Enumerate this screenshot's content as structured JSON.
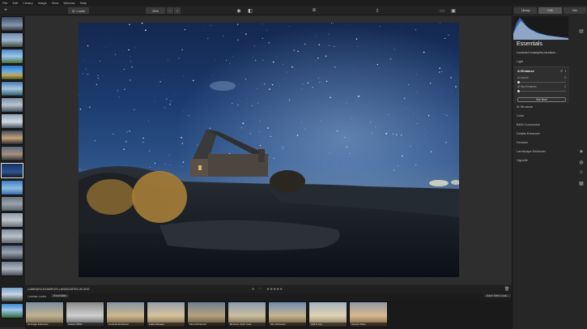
{
  "menu": [
    "File",
    "Edit",
    "Library",
    "Image",
    "View",
    "Window",
    "Help"
  ],
  "toolbar": {
    "looks_label": "Looks",
    "zoom_label": "39%",
    "zoom_minus": "−",
    "zoom_plus": "+"
  },
  "right_tabs": [
    "Library",
    "Edit",
    "Info"
  ],
  "panel": {
    "title": "Essentials",
    "preset": "Luminar4 examples-landsca…",
    "sections_top": "Light",
    "ai_enhance": {
      "title": "AI Enhance",
      "sliders": [
        {
          "label": "AI Accent",
          "value": "0"
        },
        {
          "label": "AI Sky Enhancer",
          "value": "0"
        }
      ],
      "button": "See More"
    },
    "sections": [
      "AI Structure",
      "Color",
      "B&W Conversion",
      "Details Enhancer",
      "Denoise",
      "Landscape Enhancer",
      "Vignette"
    ]
  },
  "info": {
    "filename": "LUMINAR4-EXAMPLES-LANDSCAPES-09.ORG",
    "rating_stars": "★★★★★"
  },
  "looks": {
    "tab1": "Luminar Looks",
    "tab2": "Essentials",
    "save": "Save New Look...",
    "items": [
      "AI Image Enhancer",
      "Classic B&W",
      "Contrast Enhancer",
      "Faded Beauty",
      "Mood Enhancer",
      "Remove Color Cast",
      "Sky Enhancer",
      "Soft & Airy",
      "Sunset Vibes"
    ]
  },
  "colors": {
    "accent": "#e0e0e0",
    "bg": "#2b2b2b"
  }
}
